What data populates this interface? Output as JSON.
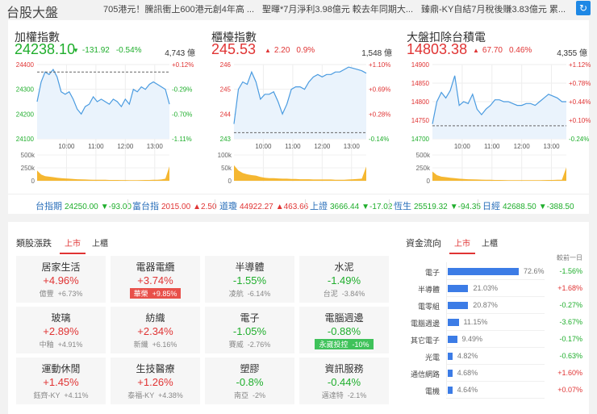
{
  "header": {
    "title": "台股大盤",
    "news": [
      "705港元！騰訊衝上600港元創4年高 ...",
      "聖暉*7月淨利3.98億元 較去年同期大...",
      "臻鼎-KY自結7月稅後賺3.83億元 累..."
    ],
    "refresh_icon": "refresh-icon"
  },
  "colors": {
    "up": "#e03434",
    "down": "#1fae2c",
    "line": "#4a9be0",
    "volume": "#f5b731",
    "bar": "#3c7ce6"
  },
  "chart_data": [
    {
      "type": "line",
      "name": "加權指數",
      "price": "24238.10",
      "arrow": "▼",
      "change": "-131.92",
      "pct": "-0.54%",
      "volume": "4,743 億",
      "dir": "down",
      "ylim": [
        24100,
        24400
      ],
      "yticks": [
        "24400",
        "24300",
        "24200",
        "24100"
      ],
      "ytick_dirs": [
        "up",
        "down",
        "down",
        "down"
      ],
      "pct_ticks": [
        "+0.12%",
        "-0.29%",
        "-0.70%",
        "-1.11%"
      ],
      "pct_dirs": [
        "up",
        "down",
        "down",
        "down"
      ],
      "ref": 24370,
      "xticks": [
        "10:00",
        "11:00",
        "12:00",
        "13:00"
      ],
      "vol_ticks": [
        "500k",
        "250k",
        "0"
      ],
      "vol_max": 500,
      "values": [
        24250,
        24330,
        24370,
        24360,
        24380,
        24350,
        24290,
        24280,
        24290,
        24260,
        24220,
        24200,
        24230,
        24240,
        24270,
        24250,
        24260,
        24250,
        24240,
        24260,
        24250,
        24230,
        24260,
        24240,
        24300,
        24290,
        24310,
        24300,
        24320,
        24330,
        24320,
        24310,
        24300,
        24240
      ],
      "vol": [
        200,
        120,
        90,
        80,
        70,
        60,
        50,
        45,
        40,
        35,
        30,
        28,
        25,
        22,
        20,
        20,
        18,
        18,
        16,
        15,
        15,
        14,
        14,
        13,
        13,
        12,
        14,
        15,
        16,
        18,
        20,
        25,
        40,
        280
      ]
    },
    {
      "type": "line",
      "name": "櫃檯指數",
      "price": "245.53",
      "arrow": "▲",
      "change": "2.20",
      "pct": "0.9%",
      "volume": "1,548 億",
      "dir": "up",
      "ylim": [
        243,
        246
      ],
      "yticks": [
        "246",
        "245",
        "244",
        "243"
      ],
      "ytick_dirs": [
        "up",
        "up",
        "up",
        "down"
      ],
      "pct_ticks": [
        "+1.10%",
        "+0.69%",
        "+0.28%",
        "-0.14%"
      ],
      "pct_dirs": [
        "up",
        "up",
        "up",
        "down"
      ],
      "ref": 243.25,
      "xticks": [
        "10:00",
        "11:00",
        "12:00",
        "13:00"
      ],
      "vol_ticks": [
        "100k",
        "50k",
        "0"
      ],
      "vol_max": 100,
      "values": [
        243.6,
        245,
        245.3,
        245.2,
        245.7,
        245.3,
        244.6,
        244.8,
        244.8,
        244.9,
        244.5,
        244,
        244.4,
        245,
        245.1,
        245.1,
        245,
        245.3,
        245.5,
        245.6,
        245.5,
        245.6,
        245.6,
        245.7,
        245.7,
        245.8,
        245.9,
        245.85,
        245.8,
        245.75,
        245.65
      ],
      "vol": [
        60,
        40,
        30,
        25,
        22,
        20,
        15,
        12,
        10,
        10,
        9,
        8,
        8,
        7,
        7,
        6,
        6,
        6,
        5,
        5,
        5,
        5,
        5,
        4,
        4,
        4,
        5,
        6,
        7,
        8,
        55
      ]
    },
    {
      "type": "line",
      "name": "大盤扣除台積電",
      "price": "14803.38",
      "arrow": "▲",
      "change": "67.70",
      "pct": "0.46%",
      "volume": "4,355 億",
      "dir": "up",
      "ylim": [
        14700,
        14900
      ],
      "yticks": [
        "14900",
        "14850",
        "14800",
        "14750",
        "14700"
      ],
      "ytick_dirs": [
        "up",
        "up",
        "up",
        "up",
        "down"
      ],
      "pct_ticks": [
        "+1.12%",
        "+0.78%",
        "+0.44%",
        "+0.10%",
        "-0.24%"
      ],
      "pct_dirs": [
        "up",
        "up",
        "up",
        "up",
        "down"
      ],
      "ref": 14735,
      "xticks": [
        "10:00",
        "11:00",
        "12:00",
        "13:00"
      ],
      "vol_ticks": [
        "500k",
        "250k",
        "0"
      ],
      "vol_max": 500,
      "values": [
        14740,
        14800,
        14825,
        14810,
        14830,
        14870,
        14790,
        14800,
        14795,
        14820,
        14780,
        14765,
        14780,
        14790,
        14805,
        14805,
        14800,
        14800,
        14795,
        14790,
        14790,
        14795,
        14795,
        14790,
        14800,
        14810,
        14820,
        14815,
        14810,
        14800,
        14800
      ],
      "vol": [
        180,
        110,
        80,
        70,
        60,
        50,
        40,
        35,
        30,
        28,
        25,
        22,
        20,
        18,
        16,
        15,
        14,
        13,
        12,
        12,
        11,
        11,
        11,
        12,
        13,
        14,
        15,
        16,
        18,
        20,
        260
      ]
    }
  ],
  "ticker": [
    {
      "label": "台指期",
      "value": "24250.00",
      "change": "▼-93.00",
      "dir": "down"
    },
    {
      "label": "富台指",
      "value": "2015.00",
      "change": "▲2.50",
      "dir": "up"
    },
    {
      "label": "道瓊",
      "value": "44922.27",
      "change": "▲463.66",
      "dir": "up"
    },
    {
      "label": "上證",
      "value": "3666.44",
      "change": "▼-17.02",
      "dir": "down"
    },
    {
      "label": "恆生",
      "value": "25519.32",
      "change": "▼-94.35",
      "dir": "down"
    },
    {
      "label": "日經",
      "value": "42688.50",
      "change": "▼-388.50",
      "dir": "down"
    }
  ],
  "sectors": {
    "title": "類股漲跌",
    "tabs": [
      "上市",
      "上櫃"
    ],
    "items": [
      {
        "name": "居家生活",
        "pct": "+4.96%",
        "dir": "up",
        "stock": "億豐  +6.73%",
        "badge": ""
      },
      {
        "name": "電器電纜",
        "pct": "+3.74%",
        "dir": "up",
        "stock": "華榮  +9.85%",
        "badge": "up"
      },
      {
        "name": "半導體",
        "pct": "-1.55%",
        "dir": "down",
        "stock": "凌航  -6.14%",
        "badge": ""
      },
      {
        "name": "水泥",
        "pct": "-1.49%",
        "dir": "down",
        "stock": "台泥  -3.84%",
        "badge": ""
      },
      {
        "name": "玻璃",
        "pct": "+2.89%",
        "dir": "up",
        "stock": "中釉  +4.91%",
        "badge": ""
      },
      {
        "name": "紡織",
        "pct": "+2.34%",
        "dir": "up",
        "stock": "新纖  +6.16%",
        "badge": ""
      },
      {
        "name": "電子",
        "pct": "-1.05%",
        "dir": "down",
        "stock": "賽威  -2.76%",
        "badge": ""
      },
      {
        "name": "電腦週邊",
        "pct": "-0.88%",
        "dir": "down",
        "stock": "永崴投控  -10%",
        "badge": "down"
      },
      {
        "name": "運動休閒",
        "pct": "+1.45%",
        "dir": "up",
        "stock": "鈺齊-KY  +4.11%",
        "badge": ""
      },
      {
        "name": "生技醫療",
        "pct": "+1.26%",
        "dir": "up",
        "stock": "泰福-KY  +4.38%",
        "badge": ""
      },
      {
        "name": "塑膠",
        "pct": "-0.8%",
        "dir": "down",
        "stock": "南亞  -2%",
        "badge": ""
      },
      {
        "name": "資訊服務",
        "pct": "-0.44%",
        "dir": "down",
        "stock": "邁達特  -2.1%",
        "badge": ""
      }
    ]
  },
  "flow": {
    "title": "資金流向",
    "tabs": [
      "上市",
      "上櫃"
    ],
    "col_header": "較前一日",
    "items": [
      {
        "label": "電子",
        "share": 72.6,
        "share_text": "72.6%",
        "chg": "-1.56%",
        "dir": "down"
      },
      {
        "label": "半導體",
        "share": 21.03,
        "share_text": "21.03%",
        "chg": "+1.68%",
        "dir": "up"
      },
      {
        "label": "電零組",
        "share": 20.87,
        "share_text": "20.87%",
        "chg": "-0.27%",
        "dir": "down"
      },
      {
        "label": "電腦週邊",
        "share": 11.15,
        "share_text": "11.15%",
        "chg": "-3.67%",
        "dir": "down"
      },
      {
        "label": "其它電子",
        "share": 9.49,
        "share_text": "9.49%",
        "chg": "-0.17%",
        "dir": "down"
      },
      {
        "label": "光電",
        "share": 4.82,
        "share_text": "4.82%",
        "chg": "-0.63%",
        "dir": "down"
      },
      {
        "label": "通信網路",
        "share": 4.68,
        "share_text": "4.68%",
        "chg": "+1.60%",
        "dir": "up"
      },
      {
        "label": "電機",
        "share": 4.64,
        "share_text": "4.64%",
        "chg": "+0.07%",
        "dir": "up"
      }
    ]
  }
}
